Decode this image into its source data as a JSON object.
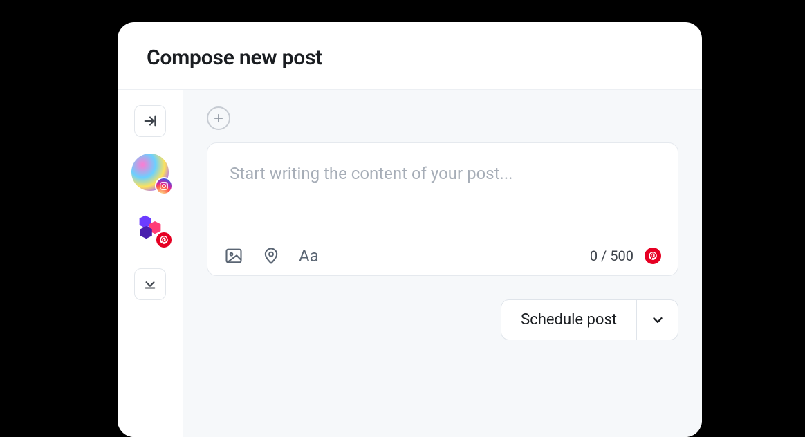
{
  "header": {
    "title": "Compose new post"
  },
  "composer": {
    "placeholder": "Start writing the content of your post...",
    "value": "",
    "char_count": "0 / 500",
    "network": "pinterest"
  },
  "sidebar": {
    "accounts": [
      {
        "type": "instagram"
      },
      {
        "type": "pinterest"
      }
    ]
  },
  "footer": {
    "schedule_label": "Schedule post"
  },
  "icons": {
    "collapse": "collapse-icon",
    "expand": "expand-down-icon",
    "add": "plus-icon",
    "image": "image-icon",
    "location": "location-pin-icon",
    "text_style": "text-style-icon",
    "chevron_down": "chevron-down-icon"
  }
}
